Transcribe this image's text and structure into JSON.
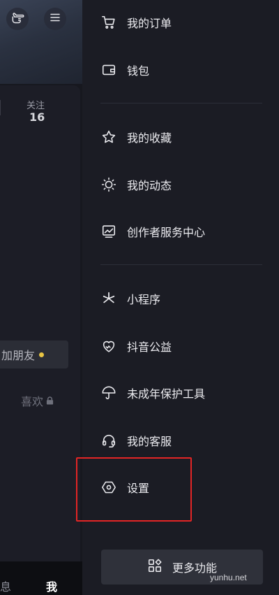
{
  "profile": {
    "stat_label": "关注",
    "stat_value": "16",
    "friend_button": "加朋友",
    "likes_tab": "喜欢"
  },
  "bottom_nav": {
    "message": "消息",
    "me": "我"
  },
  "drawer": {
    "items": [
      {
        "label": "我的订单",
        "icon": "cart-icon"
      },
      {
        "label": "钱包",
        "icon": "wallet-icon"
      },
      {
        "label": "我的收藏",
        "icon": "star-icon"
      },
      {
        "label": "我的动态",
        "icon": "sun-icon"
      },
      {
        "label": "创作者服务中心",
        "icon": "chart-monitor-icon"
      },
      {
        "label": "小程序",
        "icon": "asterisk-icon"
      },
      {
        "label": "抖音公益",
        "icon": "charity-heart-icon"
      },
      {
        "label": "未成年保护工具",
        "icon": "umbrella-icon"
      },
      {
        "label": "我的客服",
        "icon": "headset-icon"
      },
      {
        "label": "设置",
        "icon": "hex-nut-icon"
      }
    ],
    "more_button": "更多功能"
  },
  "watermark": "yunhu.net",
  "colors": {
    "highlight": "#e32525",
    "drawer_bg": "#1b1c24",
    "accent_dot": "#e8c443"
  }
}
